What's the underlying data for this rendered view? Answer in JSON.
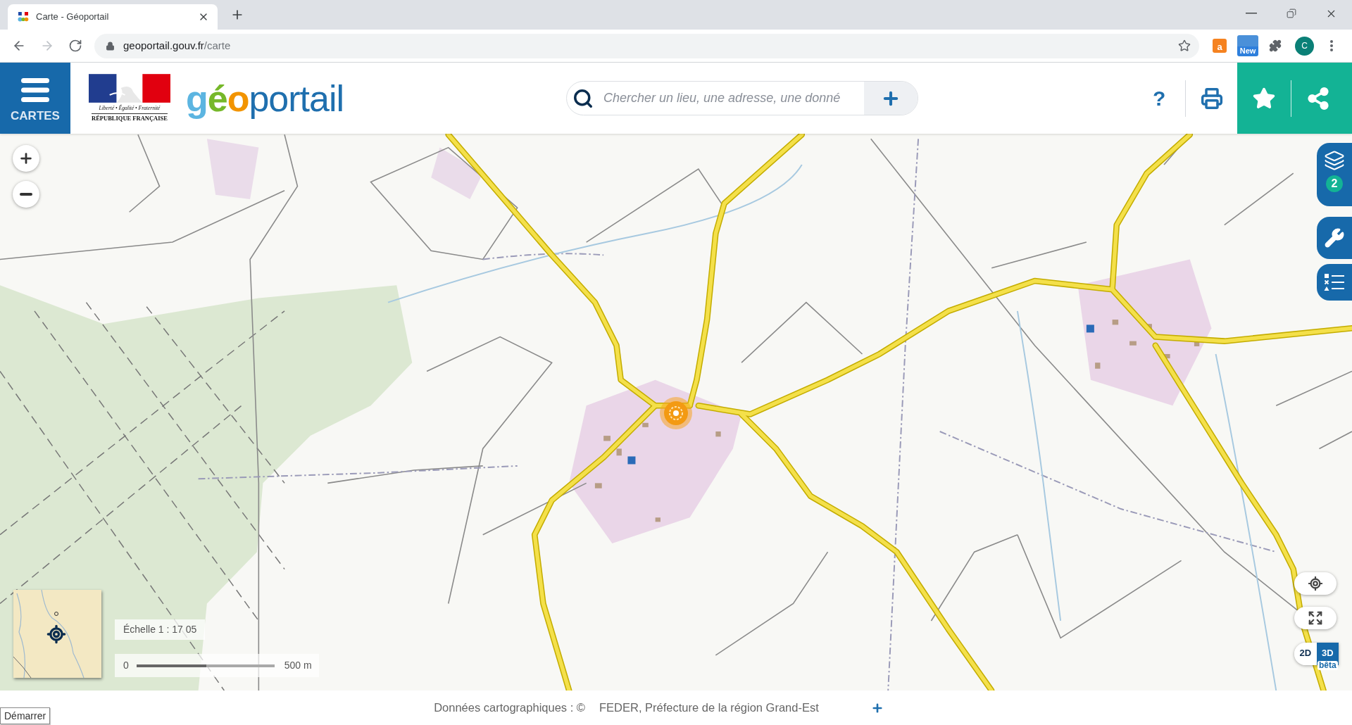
{
  "browser": {
    "tab": {
      "title": "Carte - Géoportail"
    },
    "nav_buttons": [
      {
        "kind": "back",
        "disabled": false
      },
      {
        "kind": "forward",
        "disabled": true
      },
      {
        "kind": "reload",
        "disabled": false
      }
    ],
    "address_bar": {
      "domain": "geoportail.gouv.fr",
      "path": "/carte"
    },
    "extensions": [
      {
        "kind": "shopping",
        "label": "a"
      },
      {
        "kind": "new",
        "label": "New"
      },
      {
        "kind": "puzzle"
      }
    ],
    "profile": {
      "initial": "C"
    }
  },
  "header": {
    "menu_button": {
      "label": "CARTES"
    },
    "emblem": {
      "motto": "Liberté • Égalité • Fraternité",
      "name": "RÉPUBLIQUE FRANÇAISE"
    },
    "logo": "géoportail",
    "search": {
      "placeholder": "Chercher un lieu, une adresse, une donné"
    },
    "help_button": {
      "label": "?"
    }
  },
  "map": {
    "layers_badge": "2",
    "scale": {
      "label": "Échelle 1 : 17 05",
      "start": "0",
      "end": "500 m"
    },
    "view_toggle": [
      {
        "label": "2D",
        "selected": false
      },
      {
        "label": "3D",
        "selected": true
      }
    ],
    "beta_badge": "bêta"
  },
  "footer": {
    "start_button": "Démarrer",
    "attribution_label": "Données cartographiques : ©",
    "attribution_sources": "FEDER, Préfecture de la région Grand-Est"
  }
}
